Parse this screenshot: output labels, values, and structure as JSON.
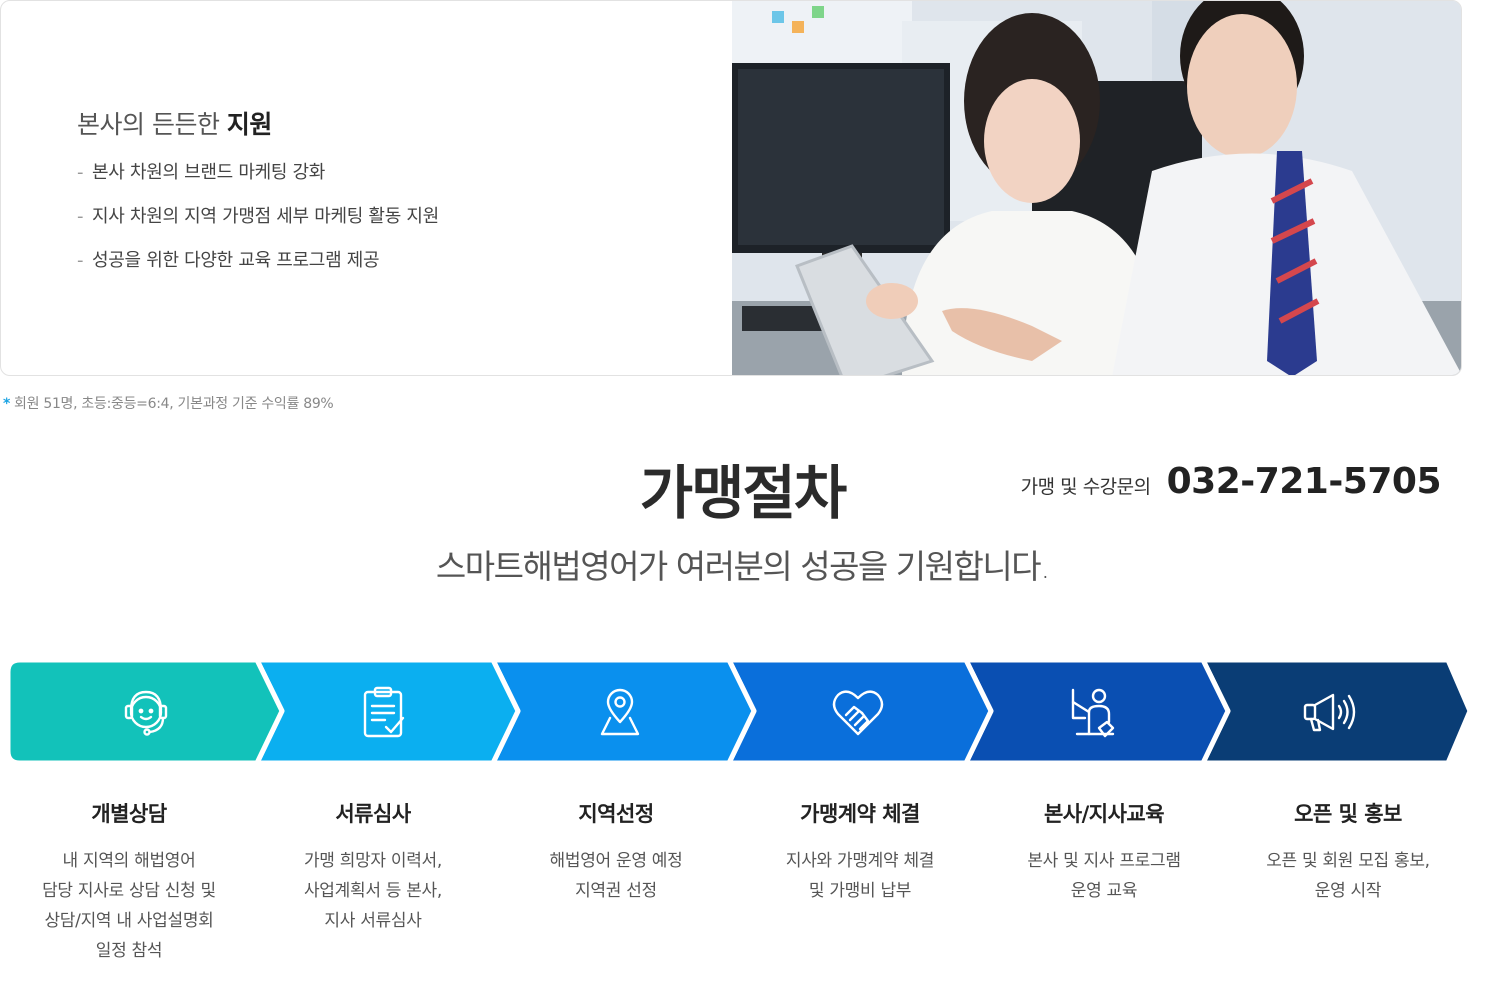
{
  "support": {
    "title_light": "본사의 든든한",
    "title_bold": "지원",
    "items": [
      "본사 차원의 브랜드 마케팅 강화",
      "지사 차원의 지역 가맹점 세부 마케팅 활동 지원",
      "성공을 위한 다양한 교육 프로그램 제공"
    ],
    "photo_icon": "business-people-tablet-photo"
  },
  "footnote": {
    "star": "*",
    "text": "회원 51명, 초등:중등=6:4, 기본과정 기준 수익률 89%"
  },
  "process": {
    "title": "가맹절차",
    "contact_label": "가맹 및 수강문의",
    "contact_phone": "032-721-5705",
    "subtitle": "스마트해법영어가 여러분의 성공을 기원합니다.",
    "colors": [
      "#12c2ba",
      "#0baff0",
      "#0a90ee",
      "#0a6fdb",
      "#0a4fb2",
      "#0a3d75"
    ],
    "steps": [
      {
        "title": "개별상담",
        "desc": [
          "내 지역의 해법영어",
          "담당 지사로 상담 신청 및",
          "상담/지역 내 사업설명회",
          "일정 참석"
        ],
        "icon": "headset-agent-icon"
      },
      {
        "title": "서류심사",
        "desc": [
          "가맹 희망자 이력서,",
          "사업계획서 등 본사,",
          "지사 서류심사"
        ],
        "icon": "clipboard-check-icon"
      },
      {
        "title": "지역선정",
        "desc": [
          "해법영어 운영 예정",
          "지역권 선정"
        ],
        "icon": "map-pin-icon"
      },
      {
        "title": "가맹계약 체결",
        "desc": [
          "지사와 가맹계약 체결",
          "및 가맹비 납부"
        ],
        "icon": "handshake-heart-icon"
      },
      {
        "title": "본사/지사교육",
        "desc": [
          "본사 및 지사 프로그램",
          "운영 교육"
        ],
        "icon": "teacher-board-icon"
      },
      {
        "title": "오픈 및 홍보",
        "desc": [
          "오픈 및 회원 모집 홍보,",
          "운영 시작"
        ],
        "icon": "megaphone-icon"
      }
    ]
  }
}
